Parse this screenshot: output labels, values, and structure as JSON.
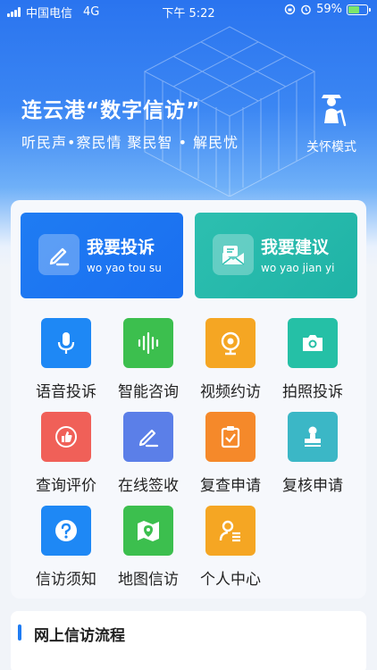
{
  "status_bar": {
    "carrier": "中国电信",
    "network": "4G",
    "time": "下午 5:22",
    "battery": "59%",
    "battery_level": 0.59
  },
  "hero": {
    "title": "连云港“数字信访”",
    "subtitle": "听民声•察民情 聚民智 • 解民忧",
    "care_mode_label": "关怀模式",
    "care_mode_icon": "elderly-person-icon"
  },
  "actions": {
    "complain": {
      "title": "我要投诉",
      "pinyin": "wo yao tou su",
      "icon": "pen-icon",
      "color": "#1f7cf3"
    },
    "suggest": {
      "title": "我要建议",
      "pinyin": "wo yao jian yi",
      "icon": "mail-icon",
      "color": "#2dbfb0"
    }
  },
  "services": [
    {
      "label": "语音投诉",
      "icon": "microphone-icon",
      "color": "#1e88f5"
    },
    {
      "label": "智能咨询",
      "icon": "soundwave-icon",
      "color": "#3cbf4e"
    },
    {
      "label": "视频约访",
      "icon": "webcam-icon",
      "color": "#f5a623"
    },
    {
      "label": "拍照投诉",
      "icon": "camera-icon",
      "color": "#25c0a6"
    },
    {
      "label": "查询评价",
      "icon": "thumbs-up-icon",
      "color": "#f06058"
    },
    {
      "label": "在线签收",
      "icon": "pen-icon",
      "color": "#5b7fe8"
    },
    {
      "label": "复查申请",
      "icon": "clipboard-check-icon",
      "color": "#f5892a"
    },
    {
      "label": "复核申请",
      "icon": "stamp-icon",
      "color": "#3bb7c6"
    },
    {
      "label": "信访须知",
      "icon": "question-icon",
      "color": "#1e88f5"
    },
    {
      "label": "地图信访",
      "icon": "map-pin-icon",
      "color": "#3cbf4e"
    },
    {
      "label": "个人中心",
      "icon": "user-profile-icon",
      "color": "#f5a623"
    }
  ],
  "flow": {
    "title": "网上信访流程"
  }
}
